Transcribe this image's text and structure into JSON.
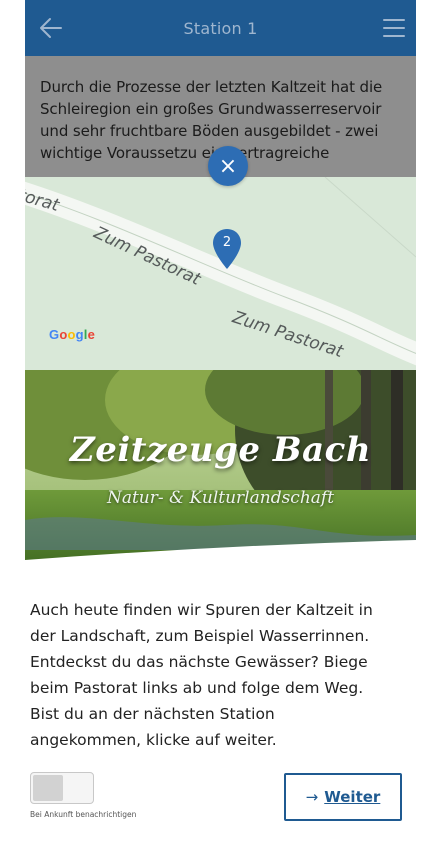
{
  "header": {
    "title": "Station 1",
    "back_icon": "arrow-left-icon",
    "menu_icon": "menu-icon"
  },
  "intro": {
    "text": "Durch die Prozesse der letzten Kaltzeit hat die Schleiregion ein großes Grundwasserreservoir und sehr fruchtbare Böden ausgebildet - zwei wichtige Voraussetzu    eine ertragreiche"
  },
  "map": {
    "streets": [
      "Zum Pastorat",
      "Zum Pastorat",
      "Zum Pastorat"
    ],
    "street_partial": "torat",
    "pin_label": "2",
    "google_letters": [
      "G",
      "o",
      "o",
      "g",
      "l",
      "e"
    ]
  },
  "close_button": {
    "glyph": "×"
  },
  "hero": {
    "title": "Zeitzeuge Bach",
    "subtitle": "Natur- & Kulturlandschaft"
  },
  "body": {
    "text": "Auch heute finden wir Spuren der Kaltzeit in der Landschaft, zum Beispiel Wasserrinnen. Entdeckst du das nächste Gewässer? Biege beim Pastorat links ab und folge dem Weg. Bist du an der nächsten Station angekommen, klicke auf weiter."
  },
  "notify": {
    "label": "Bei Ankunft benachrichtigen",
    "enabled": false
  },
  "next_button": {
    "arrow": "→",
    "label": "Weiter"
  },
  "colors": {
    "header": "#1f5a91",
    "accent": "#2d6db4",
    "map_bg": "#d9e8d8"
  }
}
